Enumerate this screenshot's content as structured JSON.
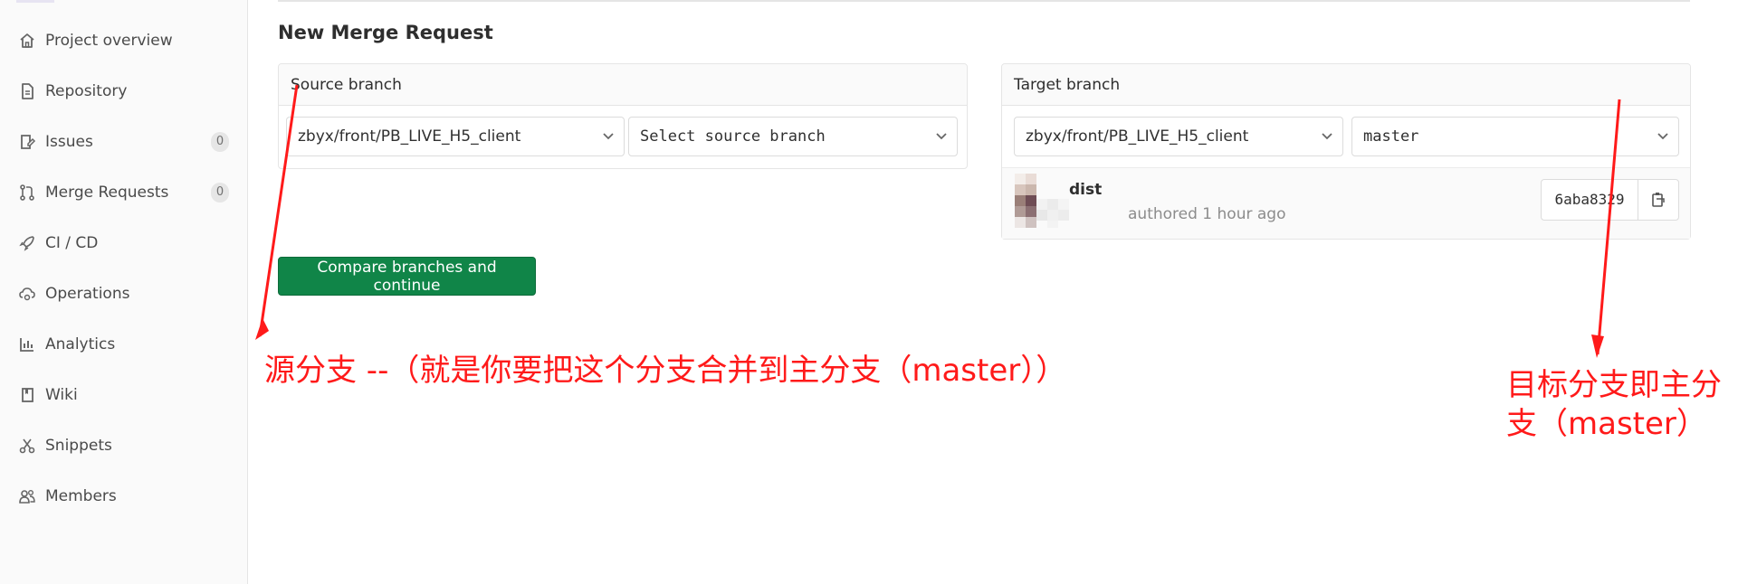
{
  "sidebar": {
    "items": [
      {
        "label": "Project overview",
        "icon": "home-icon"
      },
      {
        "label": "Repository",
        "icon": "document-icon"
      },
      {
        "label": "Issues",
        "icon": "issues-icon",
        "badge": "0"
      },
      {
        "label": "Merge Requests",
        "icon": "merge-request-icon",
        "badge": "0"
      },
      {
        "label": "CI / CD",
        "icon": "rocket-icon"
      },
      {
        "label": "Operations",
        "icon": "cloud-gear-icon"
      },
      {
        "label": "Analytics",
        "icon": "chart-icon"
      },
      {
        "label": "Wiki",
        "icon": "book-icon"
      },
      {
        "label": "Snippets",
        "icon": "scissors-icon"
      },
      {
        "label": "Members",
        "icon": "users-icon"
      }
    ]
  },
  "main": {
    "title": "New Merge Request",
    "source": {
      "header": "Source branch",
      "project": "zbyx/front/PB_LIVE_H5_client",
      "branch_placeholder": "Select source branch"
    },
    "target": {
      "header": "Target branch",
      "project": "zbyx/front/PB_LIVE_H5_client",
      "branch": "master",
      "commit": {
        "title": "dist",
        "meta": "authored 1 hour ago",
        "sha": "6aba8329"
      }
    },
    "compare_button": "Compare branches and continue"
  },
  "annotations": {
    "source_note": "源分支 --（就是你要把这个分支合并到主分支（master））",
    "target_note_line1": "目标分支即主分",
    "target_note_line2": "支（master）"
  },
  "colors": {
    "accent_green": "#108548",
    "annotation_red": "#ff1a1a",
    "sidebar_bg": "#fafafa"
  }
}
